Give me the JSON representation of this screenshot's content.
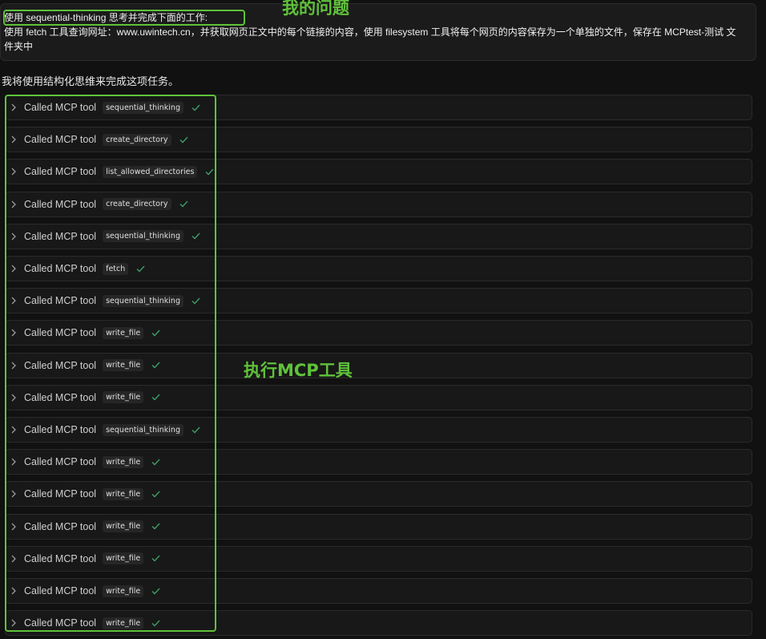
{
  "user_message": {
    "line1": "使用 sequential-thinking 思考并完成下面的工作:",
    "line2": "使用 fetch 工具查询网址：www.uwintech.cn，并获取网页正文中的每个链接的内容，使用 filesystem 工具将每个网页的内容保存为一个单独的文件，保存在 MCPtest-测试 文",
    "line3": "件夹中"
  },
  "assistant_intro": "我将使用结构化思维来完成这项任务。",
  "tool_calls": [
    {
      "label": "Called MCP tool",
      "tool": "sequential_thinking",
      "status": "done"
    },
    {
      "label": "Called MCP tool",
      "tool": "create_directory",
      "status": "done"
    },
    {
      "label": "Called MCP tool",
      "tool": "list_allowed_directories",
      "status": "done"
    },
    {
      "label": "Called MCP tool",
      "tool": "create_directory",
      "status": "done"
    },
    {
      "label": "Called MCP tool",
      "tool": "sequential_thinking",
      "status": "done"
    },
    {
      "label": "Called MCP tool",
      "tool": "fetch",
      "status": "done"
    },
    {
      "label": "Called MCP tool",
      "tool": "sequential_thinking",
      "status": "done"
    },
    {
      "label": "Called MCP tool",
      "tool": "write_file",
      "status": "done"
    },
    {
      "label": "Called MCP tool",
      "tool": "write_file",
      "status": "done"
    },
    {
      "label": "Called MCP tool",
      "tool": "write_file",
      "status": "done"
    },
    {
      "label": "Called MCP tool",
      "tool": "sequential_thinking",
      "status": "done"
    },
    {
      "label": "Called MCP tool",
      "tool": "write_file",
      "status": "done"
    },
    {
      "label": "Called MCP tool",
      "tool": "write_file",
      "status": "done"
    },
    {
      "label": "Called MCP tool",
      "tool": "write_file",
      "status": "done"
    },
    {
      "label": "Called MCP tool",
      "tool": "write_file",
      "status": "done"
    },
    {
      "label": "Called MCP tool",
      "tool": "write_file",
      "status": "done"
    },
    {
      "label": "Called MCP tool",
      "tool": "write_file",
      "status": "done"
    }
  ],
  "annotations": {
    "question_label": "我的问题",
    "tools_label": "执行MCP工具",
    "color": "#5fc23a"
  },
  "colors": {
    "background": "#111111",
    "row_background": "#181818",
    "check": "#3fa06a"
  }
}
